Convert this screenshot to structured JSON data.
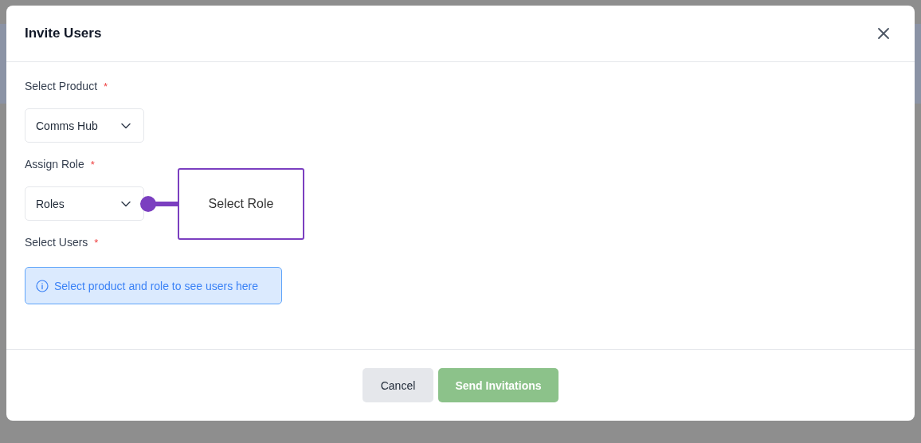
{
  "dialog": {
    "title": "Invite Users"
  },
  "fields": [
    {
      "label": "Select Product",
      "required_mark": "*",
      "kind": "select",
      "value": "Comms Hub"
    },
    {
      "label": "Assign Role",
      "required_mark": "*",
      "kind": "select",
      "value": "Roles"
    },
    {
      "label": "Select Users",
      "required_mark": "*",
      "kind": "info",
      "message": "Select product and role to see users here"
    }
  ],
  "callout": {
    "text": "Select Role"
  },
  "buttons": [
    {
      "label": "Cancel",
      "kind": "secondary",
      "disabled": false
    },
    {
      "label": "Send Invitations",
      "kind": "primary",
      "disabled": true
    }
  ]
}
